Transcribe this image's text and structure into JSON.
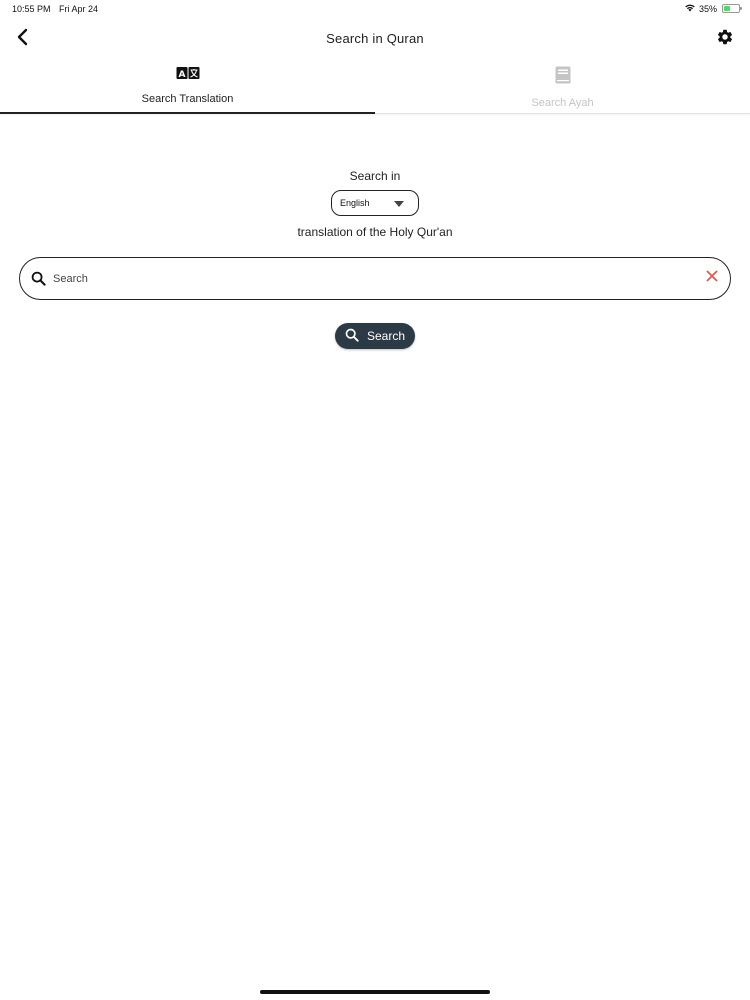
{
  "status_bar": {
    "time": "10:55 PM",
    "date": "Fri Apr 24",
    "battery_text": "35%",
    "battery_level": 0.35,
    "wifi_icon": "wifi-icon",
    "battery_icon": "battery-charging-icon"
  },
  "nav": {
    "title": "Search in Quran",
    "back_icon": "chevron-left-icon",
    "settings_icon": "gear-icon"
  },
  "tabs": [
    {
      "label": "Search Translation",
      "icon": "translate-icon",
      "active": true
    },
    {
      "label": "Search Ayah",
      "icon": "book-icon",
      "active": false
    }
  ],
  "main": {
    "search_in_label": "Search in",
    "language": "English",
    "translation_label": "translation of the Holy Qur'an",
    "search_placeholder": "Search",
    "search_value": "",
    "search_button_label": "Search"
  },
  "colors": {
    "button_bg": "#2c3a45",
    "clear_icon": "#e05a4f",
    "inactive_tab": "#c4c4c4",
    "battery_fill": "#4cd964"
  }
}
